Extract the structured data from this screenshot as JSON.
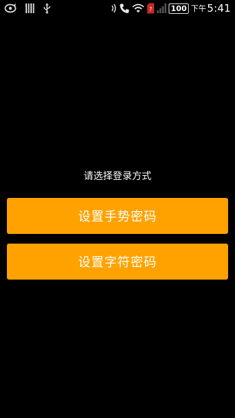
{
  "status_bar": {
    "notification_icons": [
      "sync-icon",
      "storage-icon",
      "usb-icon"
    ],
    "system_icons": [
      "nfc-icon",
      "call-icon",
      "wifi-icon",
      "sim-icon",
      "signal-icon"
    ],
    "battery_level": "100",
    "time_ampm": "下午",
    "time": "5:41"
  },
  "login": {
    "prompt": "请选择登录方式",
    "gesture_button_label": "设置手势密码",
    "text_button_label": "设置字符密码"
  },
  "colors": {
    "background": "#000000",
    "button": "#ffa200",
    "text": "#ffffff"
  }
}
